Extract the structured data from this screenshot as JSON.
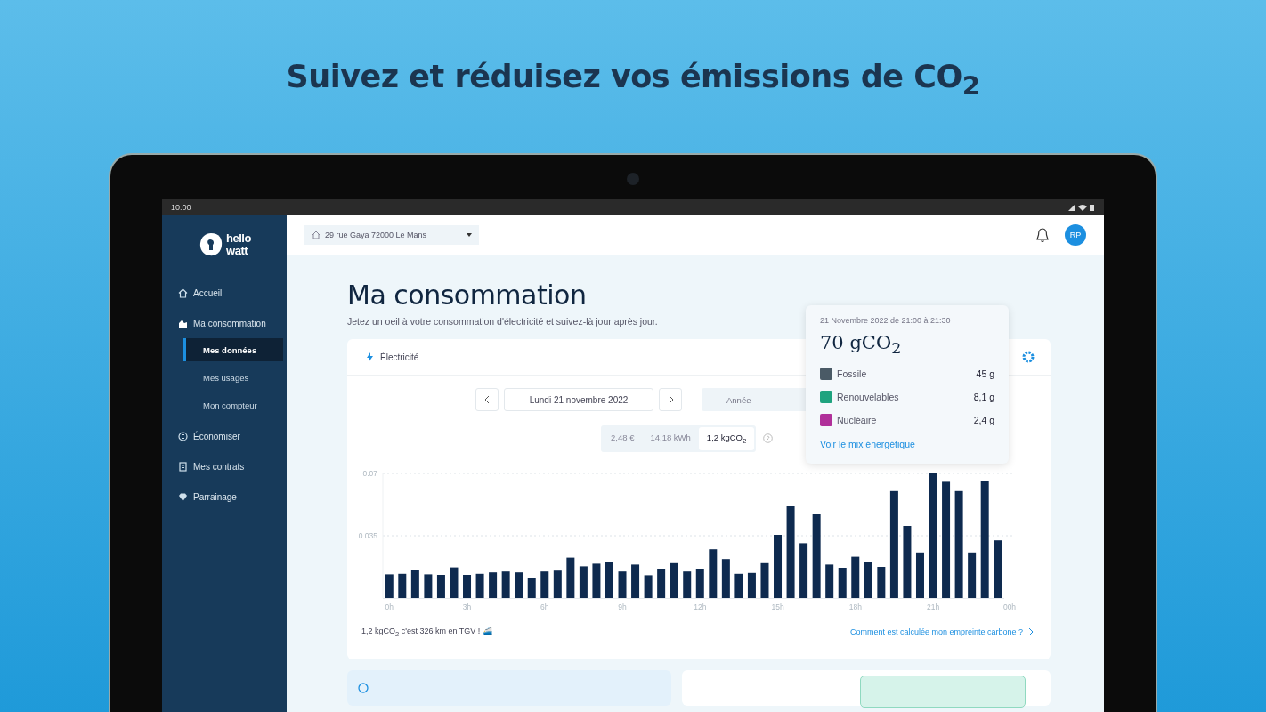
{
  "headline": "Suivez et réduisez vos émissions de CO$_{2}$",
  "status_bar": {
    "time": "10:00"
  },
  "sidebar": {
    "logo_text": [
      "hello",
      "watt"
    ],
    "items": [
      {
        "label": "Accueil",
        "selected": false
      },
      {
        "label": "Ma consommation",
        "selected": false,
        "children": [
          {
            "label": "Mes données",
            "selected": true
          },
          {
            "label": "Mes usages",
            "selected": false
          },
          {
            "label": "Mon compteur",
            "selected": false
          }
        ]
      },
      {
        "label": "Économiser",
        "selected": false
      },
      {
        "label": "Mes contrats",
        "selected": false
      },
      {
        "label": "Parrainage",
        "selected": false
      }
    ]
  },
  "topbar": {
    "address": "29 rue Gaya 72000 Le Mans",
    "avatar": "RP"
  },
  "page": {
    "title": "Ma consommation",
    "subtitle": "Jetez un oeil à votre consommation d'électricité et suivez-là jour après jour."
  },
  "card": {
    "energy_tab": "Électricité",
    "date": "Lundi 21 novembre 2022",
    "periods": [
      {
        "label": "Année",
        "selected": false
      }
    ],
    "units": [
      {
        "label": "2,48 €",
        "selected": false
      },
      {
        "label": "14,18 kWh",
        "selected": false
      },
      {
        "label": "1,2 kgCO$_{2}$",
        "selected": true
      }
    ],
    "chart_data": {
      "type": "bar",
      "x": [
        0,
        0.5,
        1,
        1.5,
        2,
        2.5,
        3,
        3.5,
        4,
        4.5,
        5,
        5.5,
        6,
        6.5,
        7,
        7.5,
        8,
        8.5,
        9,
        9.5,
        10,
        10.5,
        11,
        11.5,
        12,
        12.5,
        13,
        13.5,
        14,
        14.5,
        15,
        15.5,
        16,
        16.5,
        17,
        17.5,
        18,
        18.5,
        19,
        19.5,
        20,
        20.5,
        21,
        21.5,
        22,
        22.5,
        23,
        23.5
      ],
      "values": [
        0.0133,
        0.0136,
        0.0159,
        0.0133,
        0.013,
        0.0172,
        0.013,
        0.0136,
        0.0144,
        0.0149,
        0.0144,
        0.011,
        0.0149,
        0.0154,
        0.0227,
        0.0178,
        0.0193,
        0.0201,
        0.0149,
        0.0188,
        0.0128,
        0.0165,
        0.0196,
        0.0149,
        0.0165,
        0.0274,
        0.0219,
        0.0136,
        0.0141,
        0.0196,
        0.0355,
        0.0517,
        0.0308,
        0.0473,
        0.0188,
        0.017,
        0.0232,
        0.0204,
        0.0175,
        0.0601,
        0.0405,
        0.0256,
        0.07,
        0.0653,
        0.0601,
        0.0256,
        0.0658,
        0.0324
      ],
      "ylim": [
        0,
        0.07
      ],
      "xlim": [
        -0.25,
        23.75
      ],
      "yticks": [
        {
          "value": 0.035,
          "label": "0.035"
        },
        {
          "value": 0.07,
          "label": "0.07"
        }
      ],
      "xticks": [
        {
          "value": 0,
          "label": "0h"
        },
        {
          "value": 3,
          "label": "3h"
        },
        {
          "value": 6,
          "label": "6h"
        },
        {
          "value": 9,
          "label": "9h"
        },
        {
          "value": 12,
          "label": "12h"
        },
        {
          "value": 15,
          "label": "15h"
        },
        {
          "value": 18,
          "label": "18h"
        },
        {
          "value": 21,
          "label": "21h"
        }
      ]
    },
    "axis_end_label": "00h",
    "equivalence": "1,2 kgCO$_{2}$ c'est 326 km en TGV ! 🚄",
    "method_link": "Comment est calculée mon empreinte carbone ?"
  },
  "tooltip": {
    "period": "21 Novembre 2022 de 21:00 à 21:30",
    "total": "70 gCO$_{2}$",
    "sources": [
      {
        "name": "Fossile",
        "value": "45 g",
        "color": "#4a5a66"
      },
      {
        "name": "Renouvelables",
        "value": "8,1 g",
        "color": "#1fa37f"
      },
      {
        "name": "Nucléaire",
        "value": "2,4 g",
        "color": "#b0309a"
      }
    ],
    "link": "Voir le mix énergétique"
  }
}
